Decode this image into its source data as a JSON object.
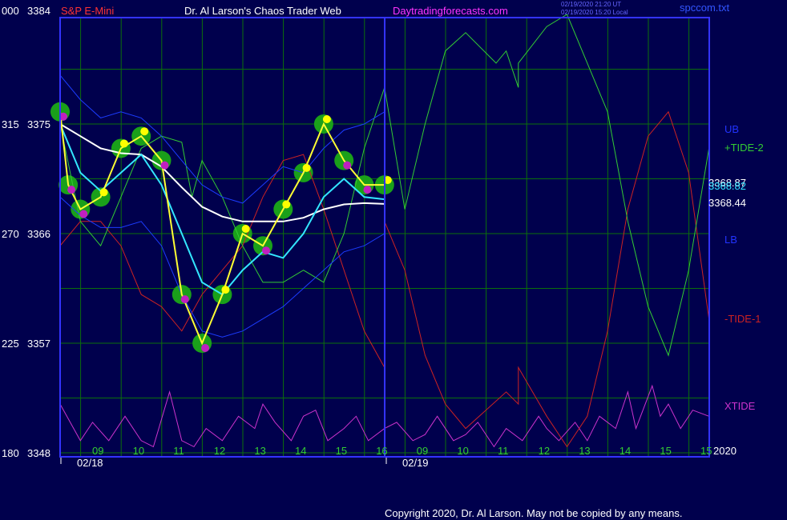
{
  "header": {
    "left_code": "000",
    "left_price": "3384",
    "symbol": "S&P E-Mini",
    "site_title": "Dr. Al Larson's Chaos Trader Web",
    "link": "Daytradingforecasts.com",
    "file": "spccom.txt",
    "timestamp_1": "02/19/2020 21:20 UT",
    "timestamp_2": "02/19/2020 15:20 Local"
  },
  "footer": {
    "copyright": "Copyright 2020, Dr. Al Larson. May not be copied by any means."
  },
  "colors": {
    "background": "#00004d",
    "grid": "#0b6f0b",
    "axis": "#3333ff",
    "price": "#ffff33",
    "cyan_ma": "#33e6ff",
    "white_ma": "#ffffff",
    "bands": "#1c3cff",
    "tide_plus": "#33cc33",
    "tide_minus": "#cc2222",
    "xtide": "#cc33cc",
    "halo": "#1aa01a",
    "dot_yellow": "#ffff00",
    "dot_magenta": "#c020c0"
  },
  "chart_data": {
    "type": "line",
    "y_axis": {
      "ticks": [
        {
          "code": "315",
          "price": 3375
        },
        {
          "code": "270",
          "price": 3366
        },
        {
          "code": "225",
          "price": 3357
        },
        {
          "code": "180",
          "price": 3348
        }
      ],
      "ylim": [
        3348,
        3384
      ]
    },
    "x_axis": {
      "hour_labels": [
        "09",
        "10",
        "11",
        "12",
        "13",
        "14",
        "15",
        "16",
        "09",
        "10",
        "11",
        "12",
        "13",
        "14",
        "15",
        "15"
      ],
      "date_labels": [
        "02/18",
        "02/19"
      ],
      "corner_label": "2020"
    },
    "right_labels": [
      {
        "text": "UB",
        "color": "#2233ff"
      },
      {
        "text": "+TIDE-2",
        "color": "#33cc33"
      },
      {
        "text": "3368.87",
        "color": "#ffffff"
      },
      {
        "text": "3368.82",
        "color": "#33e6ff"
      },
      {
        "text": "3368.44",
        "color": "#ffffff"
      },
      {
        "text": "LB",
        "color": "#2233ff"
      },
      {
        "text": "-TIDE-1",
        "color": "#cc2222"
      },
      {
        "text": "XTIDE",
        "color": "#cc33cc"
      }
    ],
    "series": [
      {
        "name": "price",
        "color": "#ffff33",
        "x": [
          0,
          0.2,
          0.5,
          1,
          1.5,
          2,
          2.5,
          3,
          3.5,
          4,
          4.5,
          5,
          5.5,
          6,
          6.5,
          7,
          7.5,
          8
        ],
        "y": [
          3376,
          3370,
          3368,
          3369,
          3373,
          3374,
          3372,
          3361,
          3357,
          3361,
          3366,
          3365,
          3368,
          3371,
          3375,
          3372,
          3370,
          3370
        ]
      },
      {
        "name": "cyan_ma",
        "color": "#33e6ff",
        "x": [
          0,
          0.5,
          1,
          1.5,
          2,
          2.5,
          3,
          3.5,
          4,
          4.5,
          5,
          5.5,
          6,
          6.5,
          7,
          7.5,
          8
        ],
        "y": [
          3375,
          3371,
          3369.5,
          3371,
          3372.5,
          3370,
          3366,
          3362,
          3361,
          3363,
          3364.5,
          3364,
          3366,
          3369,
          3370.5,
          3369,
          3368.82
        ]
      },
      {
        "name": "white_ma",
        "color": "#ffffff",
        "x": [
          0,
          0.5,
          1,
          1.5,
          2,
          2.5,
          3,
          3.5,
          4,
          4.5,
          5,
          5.5,
          6,
          6.5,
          7,
          7.5,
          8
        ],
        "y": [
          3375,
          3374,
          3373,
          3372.6,
          3372.5,
          3371.5,
          3369.8,
          3368.2,
          3367.4,
          3367,
          3367,
          3367,
          3367.3,
          3368,
          3368.4,
          3368.5,
          3368.44
        ]
      },
      {
        "name": "UB",
        "color": "#1c3cff",
        "x": [
          0,
          0.5,
          1,
          1.5,
          2,
          2.5,
          3,
          3.5,
          4,
          4.5,
          5,
          5.5,
          6,
          6.5,
          7,
          7.5,
          8
        ],
        "y": [
          3379,
          3377,
          3375.5,
          3376,
          3375.5,
          3374,
          3372,
          3370,
          3369,
          3368.5,
          3370,
          3371.5,
          3371,
          3373,
          3374.5,
          3375,
          3376
        ]
      },
      {
        "name": "LB",
        "color": "#1c3cff",
        "x": [
          0,
          0.5,
          1,
          1.5,
          2,
          2.5,
          3,
          3.5,
          4,
          4.5,
          5,
          5.5,
          6,
          6.5,
          7,
          7.5,
          8
        ],
        "y": [
          3369,
          3367.5,
          3366.5,
          3366.5,
          3367,
          3365,
          3361,
          3358,
          3357.5,
          3358,
          3359,
          3360,
          3361.5,
          3363,
          3364.5,
          3365,
          3366
        ]
      },
      {
        "name": "+TIDE-2",
        "color": "#33cc33",
        "x": [
          0,
          0.5,
          1,
          1.5,
          2,
          2.5,
          3,
          3.25,
          3.5,
          4,
          4.5,
          5,
          5.5,
          6,
          6.5,
          7,
          7.5,
          8,
          8.5,
          9,
          9.5,
          10,
          10.75,
          11,
          11.3,
          11.3,
          12,
          12.5,
          13,
          13.5,
          14,
          14.5,
          15,
          15.5,
          16
        ],
        "y": [
          3375,
          3367,
          3365,
          3369,
          3373,
          3374,
          3373.5,
          3369,
          3372,
          3369,
          3365,
          3362,
          3362,
          3363,
          3362,
          3366,
          3373,
          3378,
          3368,
          3375,
          3381,
          3382.5,
          3380,
          3381,
          3378,
          3380,
          3383,
          3384,
          3380,
          3376,
          3367,
          3360,
          3356,
          3363,
          3373
        ]
      },
      {
        "name": "-TIDE-1",
        "color": "#cc2222",
        "x": [
          0,
          0.5,
          1,
          1.5,
          2,
          2.5,
          3,
          3.5,
          4,
          4.5,
          5,
          5.5,
          6,
          6.5,
          7,
          7.5,
          8,
          8,
          8.5,
          9,
          9.5,
          10,
          11,
          11.3,
          11.3,
          12,
          12.5,
          13,
          13.5,
          14,
          14.5,
          15,
          15.5,
          16
        ],
        "y": [
          3365,
          3367,
          3367,
          3365,
          3361,
          3360,
          3358,
          3361,
          3363,
          3365,
          3369,
          3372,
          3372.5,
          3368,
          3363,
          3358,
          3355,
          3367,
          3363,
          3356,
          3352,
          3350,
          3353,
          3352,
          3355,
          3351,
          3348.5,
          3351,
          3358,
          3368,
          3374,
          3376,
          3371,
          3359
        ]
      },
      {
        "name": "XTIDE",
        "color": "#cc33cc",
        "x": [
          0,
          0.5,
          0.8,
          1.2,
          1.6,
          2,
          2.3,
          2.7,
          3,
          3.3,
          3.6,
          4,
          4.4,
          4.8,
          5,
          5.3,
          5.7,
          6,
          6.3,
          6.6,
          7,
          7.3,
          7.6,
          8,
          8.3,
          8.7,
          9,
          9.3,
          9.7,
          10,
          10.3,
          10.7,
          11,
          11.4,
          11.8,
          12,
          12.3,
          12.7,
          13,
          13.3,
          13.7,
          14,
          14.2,
          14.6,
          14.8,
          15,
          15.3,
          15.6,
          16
        ],
        "y": [
          3352,
          3349,
          3350.5,
          3349,
          3351,
          3349,
          3348.5,
          3353,
          3349,
          3348.5,
          3350,
          3349,
          3351,
          3350,
          3352,
          3350.5,
          3349,
          3351,
          3351.5,
          3349,
          3350,
          3351,
          3349,
          3350,
          3350.5,
          3349,
          3349.5,
          3351,
          3349,
          3349.5,
          3350.5,
          3348.5,
          3350,
          3349,
          3351,
          3350,
          3349,
          3350.5,
          3349,
          3351,
          3350,
          3353,
          3350,
          3353.5,
          3351,
          3352,
          3350,
          3351.5,
          3351
        ]
      }
    ]
  }
}
